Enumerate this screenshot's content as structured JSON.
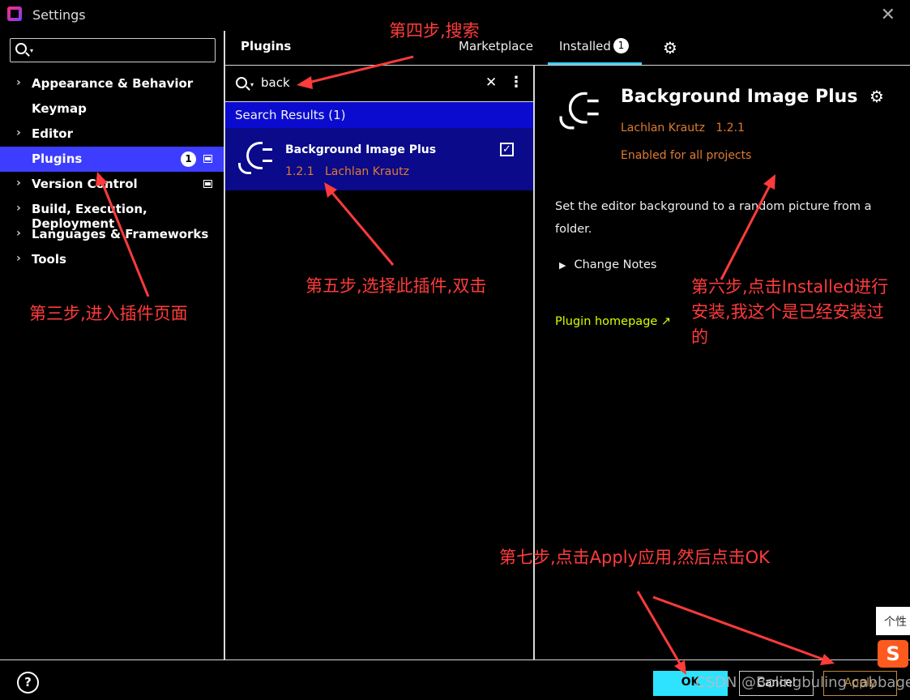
{
  "window": {
    "title": "Settings",
    "close_glyph": "✕"
  },
  "sidebar": {
    "search_placeholder": "",
    "items": [
      {
        "label": "Appearance & Behavior",
        "chevron": "›"
      },
      {
        "label": "Keymap",
        "chevron": ""
      },
      {
        "label": "Editor",
        "chevron": "›"
      },
      {
        "label": "Plugins",
        "chevron": "",
        "badge": "1",
        "selected": true
      },
      {
        "label": "Version Control",
        "chevron": "›"
      },
      {
        "label": "Build, Execution, Deployment",
        "chevron": "›"
      },
      {
        "label": "Languages & Frameworks",
        "chevron": "›"
      },
      {
        "label": "Tools",
        "chevron": "›"
      }
    ]
  },
  "plugins": {
    "title": "Plugins",
    "tabs": {
      "marketplace": "Marketplace",
      "installed": "Installed",
      "installed_count": "1"
    },
    "gear_glyph": "⚙"
  },
  "list": {
    "query": "back",
    "clear_glyph": "✕",
    "more_glyph": "⋮",
    "results_header": "Search Results (1)",
    "result": {
      "name": "Background Image Plus",
      "version": "1.2.1",
      "vendor": "Lachlan Krautz",
      "check_glyph": "✓"
    }
  },
  "detail": {
    "name": "Background Image Plus",
    "vendor": "Lachlan Krautz",
    "version": "1.2.1",
    "status": "Enabled for all projects",
    "description": "Set the editor background to a random picture from a folder.",
    "change_notes": "Change Notes",
    "homepage": "Plugin homepage ↗",
    "gear_glyph": "⚙",
    "triangle_glyph": "▶"
  },
  "footer": {
    "help_glyph": "?",
    "ok": "OK",
    "cancel": "Cancel",
    "apply": "Apply",
    "watermark": "CSDN @Bolingbuling cabbage"
  },
  "ime": {
    "tip": "个性",
    "logo": "S"
  },
  "annotations": {
    "step3": "第三步,进入插件页面",
    "step4": "第四步,搜索",
    "step5": "第五步,选择此插件,双击",
    "step6_l1": "第六步,点击Installed进行",
    "step6_l2": "安装,我这个是已经安装过",
    "step6_l3": "的",
    "step7": "第七步,点击Apply应用,然后点击OK",
    "color": "#ff3b3b"
  },
  "colors": {
    "selection": "#3d3dff",
    "results_header": "#0b0bd0",
    "result_row": "#0a0a8a",
    "accent_cyan": "#2ee3ff",
    "vendor_orange": "#e07a30",
    "link": "#d6ff00"
  }
}
